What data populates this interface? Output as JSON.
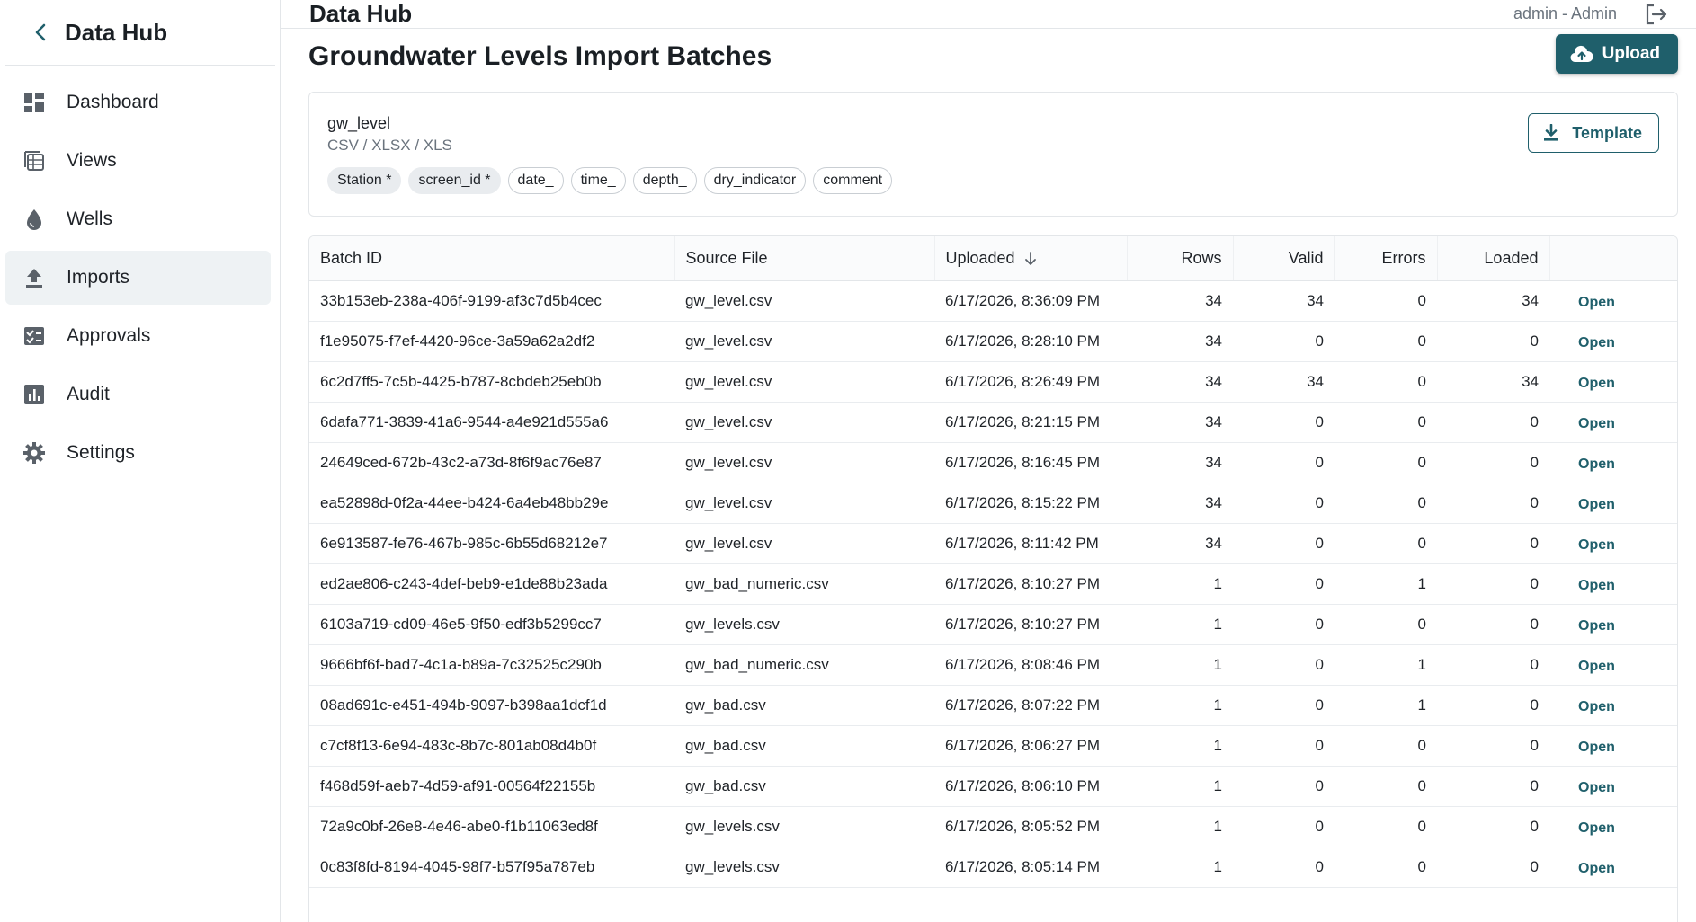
{
  "sidebar": {
    "brand": "Data Hub",
    "items": [
      {
        "label": "Dashboard",
        "icon": "dashboard-icon"
      },
      {
        "label": "Views",
        "icon": "views-icon"
      },
      {
        "label": "Wells",
        "icon": "drop-icon"
      },
      {
        "label": "Imports",
        "icon": "upload-icon",
        "active": true
      },
      {
        "label": "Approvals",
        "icon": "approval-icon"
      },
      {
        "label": "Audit",
        "icon": "chart-icon"
      },
      {
        "label": "Settings",
        "icon": "gear-icon"
      }
    ]
  },
  "topbar": {
    "title": "Data Hub",
    "user": "admin - Admin"
  },
  "page": {
    "heading": "Groundwater Levels Import Batches",
    "upload_label": "Upload"
  },
  "schema": {
    "name": "gw_level",
    "formats": "CSV / XLSX / XLS",
    "template_label": "Template",
    "fields": [
      {
        "label": "Station *",
        "required": true
      },
      {
        "label": "screen_id *",
        "required": true
      },
      {
        "label": "date_",
        "required": false
      },
      {
        "label": "time_",
        "required": false
      },
      {
        "label": "depth_",
        "required": false
      },
      {
        "label": "dry_indicator",
        "required": false
      },
      {
        "label": "comment",
        "required": false
      }
    ]
  },
  "table": {
    "columns": [
      "Batch ID",
      "Source File",
      "Uploaded",
      "Rows",
      "Valid",
      "Errors",
      "Loaded",
      ""
    ],
    "open_label": "Open",
    "rows": [
      [
        "33b153eb-238a-406f-9199-af3c7d5b4cec",
        "gw_level.csv",
        "6/17/2026, 8:36:09 PM",
        "34",
        "34",
        "0",
        "34"
      ],
      [
        "f1e95075-f7ef-4420-96ce-3a59a62a2df2",
        "gw_level.csv",
        "6/17/2026, 8:28:10 PM",
        "34",
        "0",
        "0",
        "0"
      ],
      [
        "6c2d7ff5-7c5b-4425-b787-8cbdeb25eb0b",
        "gw_level.csv",
        "6/17/2026, 8:26:49 PM",
        "34",
        "34",
        "0",
        "34"
      ],
      [
        "6dafa771-3839-41a6-9544-a4e921d555a6",
        "gw_level.csv",
        "6/17/2026, 8:21:15 PM",
        "34",
        "0",
        "0",
        "0"
      ],
      [
        "24649ced-672b-43c2-a73d-8f6f9ac76e87",
        "gw_level.csv",
        "6/17/2026, 8:16:45 PM",
        "34",
        "0",
        "0",
        "0"
      ],
      [
        "ea52898d-0f2a-44ee-b424-6a4eb48bb29e",
        "gw_level.csv",
        "6/17/2026, 8:15:22 PM",
        "34",
        "0",
        "0",
        "0"
      ],
      [
        "6e913587-fe76-467b-985c-6b55d68212e7",
        "gw_level.csv",
        "6/17/2026, 8:11:42 PM",
        "34",
        "0",
        "0",
        "0"
      ],
      [
        "ed2ae806-c243-4def-beb9-e1de88b23ada",
        "gw_bad_numeric.csv",
        "6/17/2026, 8:10:27 PM",
        "1",
        "0",
        "1",
        "0"
      ],
      [
        "6103a719-cd09-46e5-9f50-edf3b5299cc7",
        "gw_levels.csv",
        "6/17/2026, 8:10:27 PM",
        "1",
        "0",
        "0",
        "0"
      ],
      [
        "9666bf6f-bad7-4c1a-b89a-7c32525c290b",
        "gw_bad_numeric.csv",
        "6/17/2026, 8:08:46 PM",
        "1",
        "0",
        "1",
        "0"
      ],
      [
        "08ad691c-e451-494b-9097-b398aa1dcf1d",
        "gw_bad.csv",
        "6/17/2026, 8:07:22 PM",
        "1",
        "0",
        "1",
        "0"
      ],
      [
        "c7cf8f13-6e94-483c-8b7c-801ab08d4b0f",
        "gw_bad.csv",
        "6/17/2026, 8:06:27 PM",
        "1",
        "0",
        "0",
        "0"
      ],
      [
        "f468d59f-aeb7-4d59-af91-00564f22155b",
        "gw_bad.csv",
        "6/17/2026, 8:06:10 PM",
        "1",
        "0",
        "0",
        "0"
      ],
      [
        "72a9c0bf-26e8-4e46-abe0-f1b11063ed8f",
        "gw_levels.csv",
        "6/17/2026, 8:05:52 PM",
        "1",
        "0",
        "0",
        "0"
      ],
      [
        "0c83f8fd-8194-4045-98f7-b57f95a787eb",
        "gw_levels.csv",
        "6/17/2026, 8:05:14 PM",
        "1",
        "0",
        "0",
        "0"
      ]
    ]
  },
  "colors": {
    "accent": "#1f5f6b",
    "active_nav": "#eef2f4",
    "border": "#e3e6e9"
  }
}
